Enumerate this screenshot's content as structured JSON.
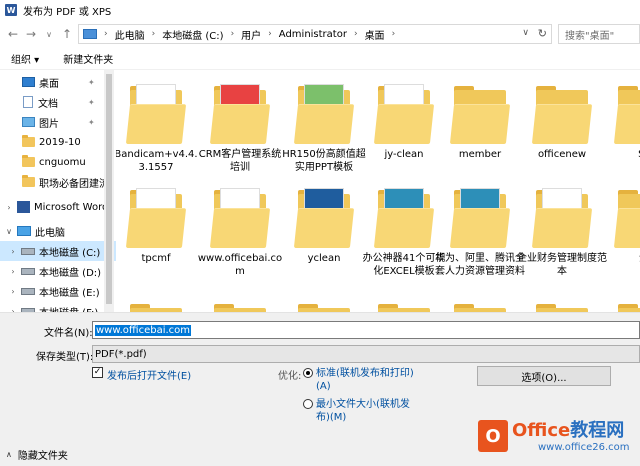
{
  "window": {
    "title": "发布为 PDF 或 XPS",
    "app_icon": "W"
  },
  "address": {
    "crumbs": [
      "此电脑",
      "本地磁盘 (C:)",
      "用户",
      "Administrator",
      "桌面"
    ],
    "search_placeholder": "搜索\"桌面\""
  },
  "toolbar": {
    "organize": "组织 ▾",
    "new_folder": "新建文件夹"
  },
  "nav": {
    "items": [
      {
        "label": "桌面",
        "icon": "desktop-icon",
        "pinned": true
      },
      {
        "label": "文档",
        "icon": "documents-icon",
        "pinned": true
      },
      {
        "label": "图片",
        "icon": "pictures-icon",
        "pinned": true
      },
      {
        "label": "2019-10",
        "icon": "folder-icon"
      },
      {
        "label": "cnguomu",
        "icon": "folder-icon"
      },
      {
        "label": "职场必备团建流",
        "icon": "folder-icon"
      },
      {
        "label": "Microsoft Word",
        "icon": "word-icon"
      },
      {
        "label": "此电脑",
        "icon": "computer-icon"
      },
      {
        "label": "本地磁盘 (C:)",
        "icon": "drive-icon"
      },
      {
        "label": "本地磁盘 (D:)",
        "icon": "drive-icon"
      },
      {
        "label": "本地磁盘 (E:)",
        "icon": "drive-icon"
      },
      {
        "label": "本地磁盘 (F:)",
        "icon": "drive-icon"
      }
    ]
  },
  "files": [
    {
      "name": "Bandicam+v4.4.3.1557",
      "style": "docs"
    },
    {
      "name": "CRM客户管理系统培训",
      "style": "red"
    },
    {
      "name": "HR150份高颜值超实用PPT模板",
      "style": "green"
    },
    {
      "name": "jy-clean",
      "style": "sheets"
    },
    {
      "name": "member",
      "style": "plain"
    },
    {
      "name": "officenew",
      "style": "plain"
    },
    {
      "name": "Sc",
      "style": "plain"
    },
    {
      "name": "tpcmf",
      "style": "docs"
    },
    {
      "name": "www.officebai.com",
      "style": "docs"
    },
    {
      "name": "yclean",
      "style": "blue"
    },
    {
      "name": "办公神器41个可视化EXCEL模板",
      "style": "teal"
    },
    {
      "name": "华为、阿里、腾讯全套人力资源管理资料",
      "style": "teal"
    },
    {
      "name": "企业财务管理制度范本",
      "style": "docs"
    },
    {
      "name": "企",
      "style": "plain"
    }
  ],
  "form": {
    "filename_label": "文件名(N):",
    "filename_value": "www.officebai.com",
    "type_label": "保存类型(T):",
    "type_value": "PDF(*.pdf)",
    "open_after": "发布后打开文件(E)",
    "optimize_label": "优化:",
    "radio_standard": "标准(联机发布和打印)(A)",
    "radio_min": "最小文件大小(联机发布)(M)",
    "options_button": "选项(O)...",
    "hide_folders": "隐藏文件夹"
  },
  "watermark": {
    "brand_a": "Office",
    "brand_b": "教程网",
    "site": "www.office26.com"
  }
}
